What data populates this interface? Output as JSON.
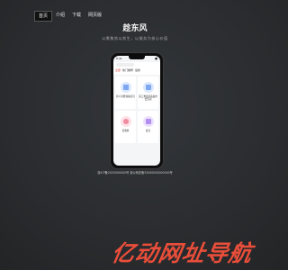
{
  "nav": {
    "items": [
      "首页",
      "介绍",
      "下载",
      "网页版"
    ]
  },
  "page": {
    "title": "趁东风",
    "tagline": "以需聚势以势生，以服务为核心价值"
  },
  "phone": {
    "status": {
      "time": "9:41",
      "battery": "■"
    },
    "tabs": [
      "全部",
      "热门推荐",
      "最新"
    ],
    "cards": [
      {
        "caption": "新人注册领取红包",
        "color": "blue"
      },
      {
        "caption": "第三季度新品发布会活动",
        "color": "blue"
      },
      {
        "caption": "优惠券",
        "color": "pink"
      },
      {
        "caption": "会员",
        "color": "purple"
      }
    ]
  },
  "footer": {
    "text": "浙ICP备2020000000号   浙公网安备33000000000000号"
  },
  "watermark": {
    "text": "亿动网址导航"
  }
}
